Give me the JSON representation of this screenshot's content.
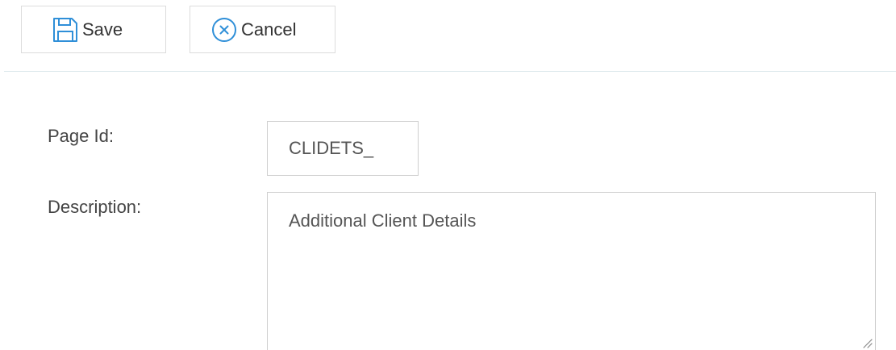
{
  "toolbar": {
    "save_label": "Save",
    "save_icon": "floppy-disk-icon",
    "cancel_label": "Cancel",
    "cancel_icon": "circle-x-icon",
    "icon_color": "#2f8fd8"
  },
  "form": {
    "page_id": {
      "label": "Page Id:",
      "value": "CLIDETS_"
    },
    "description": {
      "label": "Description:",
      "value": "Additional Client Details"
    }
  }
}
